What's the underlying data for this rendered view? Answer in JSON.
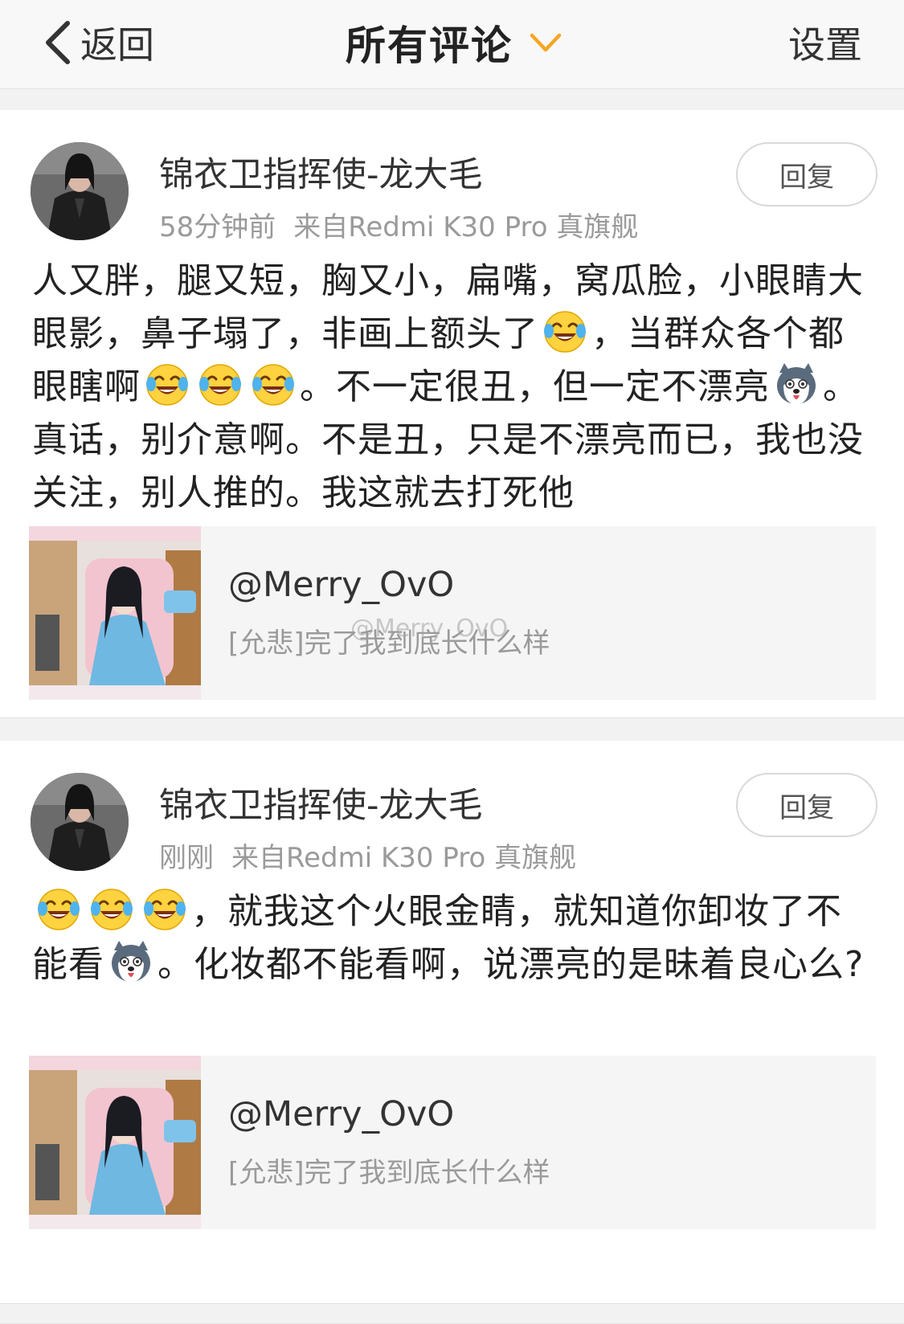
{
  "nav": {
    "back_label": "返回",
    "title": "所有评论",
    "settings_label": "设置"
  },
  "comments": [
    {
      "username": "锦衣卫指挥使-龙大毛",
      "time": "58分钟前",
      "source": "来自Redmi K30 Pro 真旗舰",
      "reply_label": "回复",
      "content": [
        {
          "t": "人又胖，腿又短，胸又小，扁嘴，窝瓜脸，小眼睛大眼影，鼻子塌了，非画上额头了"
        },
        {
          "e": "laugh-cry"
        },
        {
          "t": "，当群众各个都眼瞎啊"
        },
        {
          "e": "laugh-cry"
        },
        {
          "e": "laugh-cry"
        },
        {
          "e": "laugh-cry"
        },
        {
          "t": "。不一定很丑，但一定不漂亮"
        },
        {
          "e": "husky"
        },
        {
          "t": "。真话，别介意啊。不是丑，只是不漂亮而已，我也没关注，别人推的。我这就去打死他"
        }
      ],
      "quote": {
        "user": "@Merry_OvO",
        "text": "[允悲]完了我到底长什么样",
        "watermark": "@Merry_OvO"
      }
    },
    {
      "username": "锦衣卫指挥使-龙大毛",
      "time": "刚刚",
      "source": "来自Redmi K30 Pro 真旗舰",
      "reply_label": "回复",
      "content": [
        {
          "e": "laugh-cry"
        },
        {
          "e": "laugh-cry"
        },
        {
          "e": "laugh-cry"
        },
        {
          "t": "，就我这个火眼金睛，就知道你卸妆了不能看"
        },
        {
          "e": "husky"
        },
        {
          "t": "。化妆都不能看啊，说漂亮的是昧着良心么?"
        }
      ],
      "quote": {
        "user": "@Merry_OvO",
        "text": "[允悲]完了我到底长什么样"
      }
    }
  ],
  "colors": {
    "nav_bg": "#f8f8f8",
    "meta": "#9a9a9a",
    "dropdown": "#f5a623",
    "quote_bg": "#f5f5f5"
  }
}
